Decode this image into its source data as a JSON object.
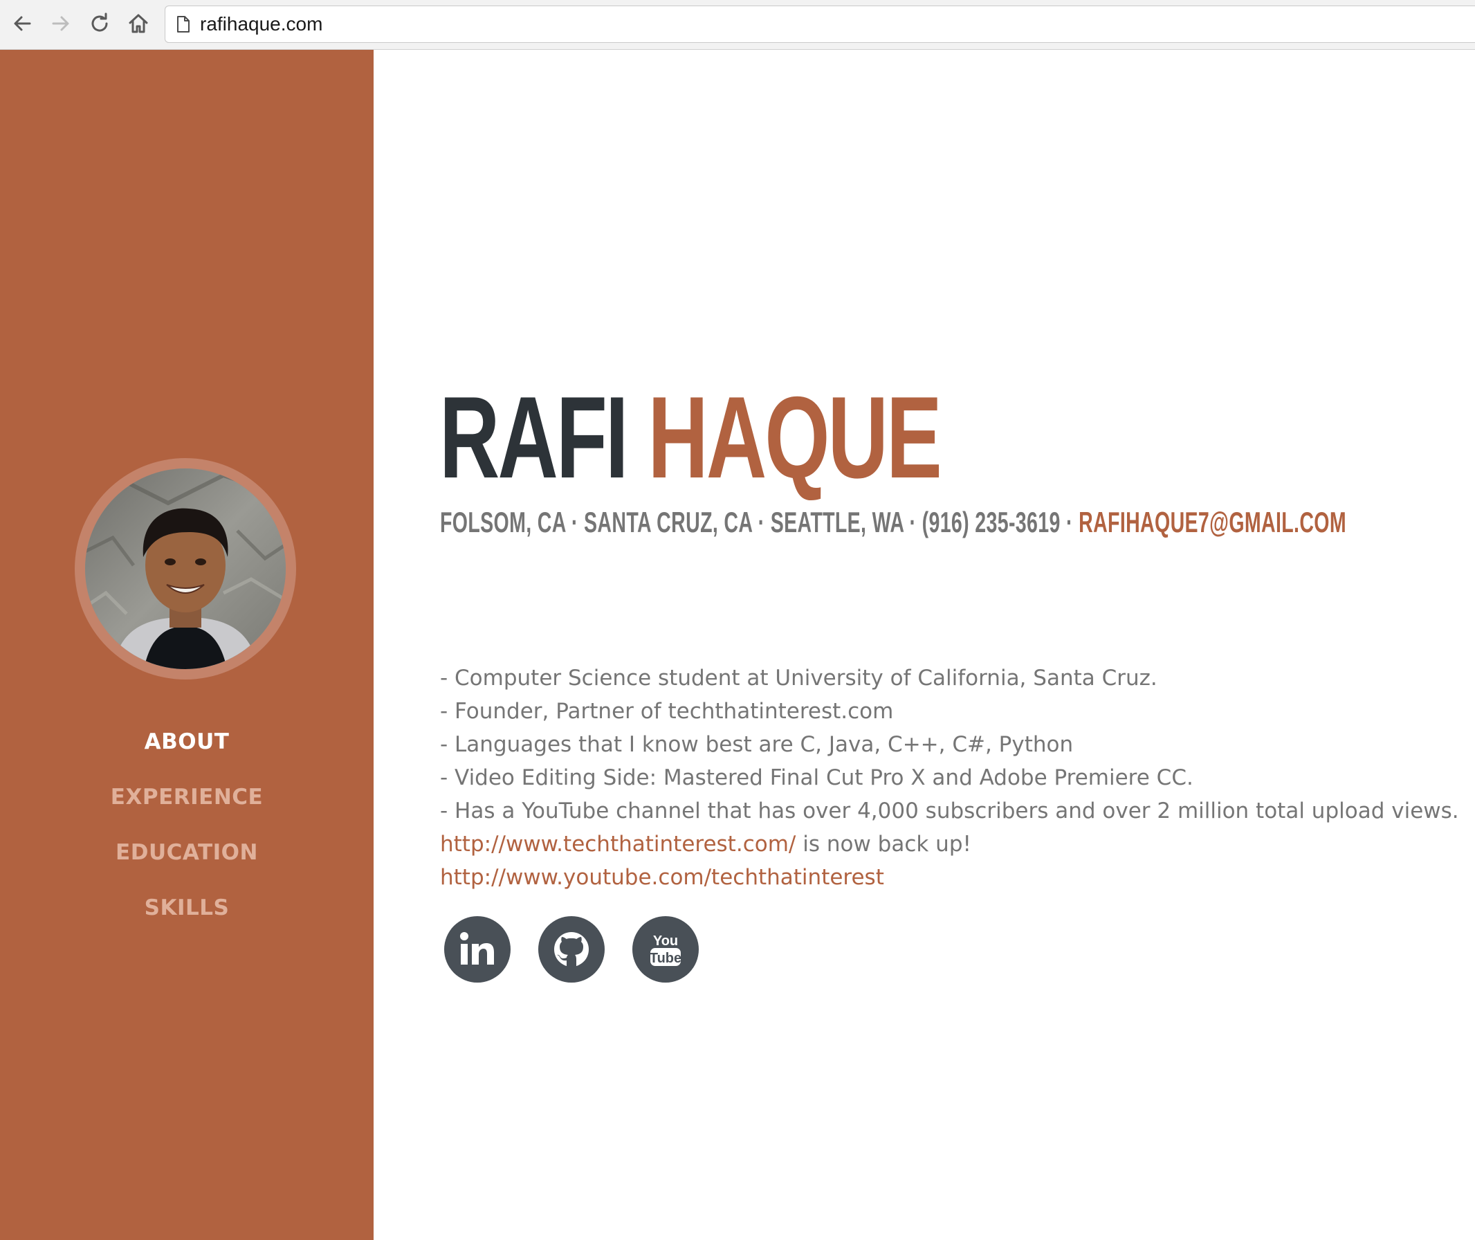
{
  "browser": {
    "url": "rafihaque.com",
    "back_icon": "arrow-left-icon",
    "forward_icon": "arrow-right-icon",
    "reload_icon": "reload-icon",
    "home_icon": "home-icon",
    "page_icon": "document-icon"
  },
  "colors": {
    "accent": "#b16240",
    "sidebar_bg": "#b16240",
    "heading_dark": "#2d3338",
    "body_text": "#757575",
    "social_bg": "#495057"
  },
  "sidebar": {
    "nav": [
      {
        "label": "ABOUT",
        "active": true
      },
      {
        "label": "EXPERIENCE",
        "active": false
      },
      {
        "label": "EDUCATION",
        "active": false
      },
      {
        "label": "SKILLS",
        "active": false
      }
    ]
  },
  "header": {
    "first_name": "RAFI",
    "last_name": "HAQUE",
    "locations": "FOLSOM, CA · SANTA CRUZ, CA · SEATTLE, WA · (916) 235-3619 · ",
    "email": "RAFIHAQUE7@GMAIL.COM"
  },
  "bio": {
    "lines": [
      "- Computer Science student at University of California, Santa Cruz.",
      "- Founder, Partner of techthatinterest.com",
      "- Languages that I know best are C, Java, C++, C#, Python",
      "- Video Editing Side: Mastered Final Cut Pro X and Adobe Premiere CC.",
      "- Has a YouTube channel that has over 4,000 subscribers and over 2 million total upload views."
    ],
    "link1": "http://www.techthatinterest.com/",
    "link1_suffix": " is now back up!",
    "link2": "http://www.youtube.com/techthatinterest"
  },
  "social": {
    "linkedin_text": "in",
    "youtube_top": "You",
    "youtube_bottom": "Tube"
  }
}
